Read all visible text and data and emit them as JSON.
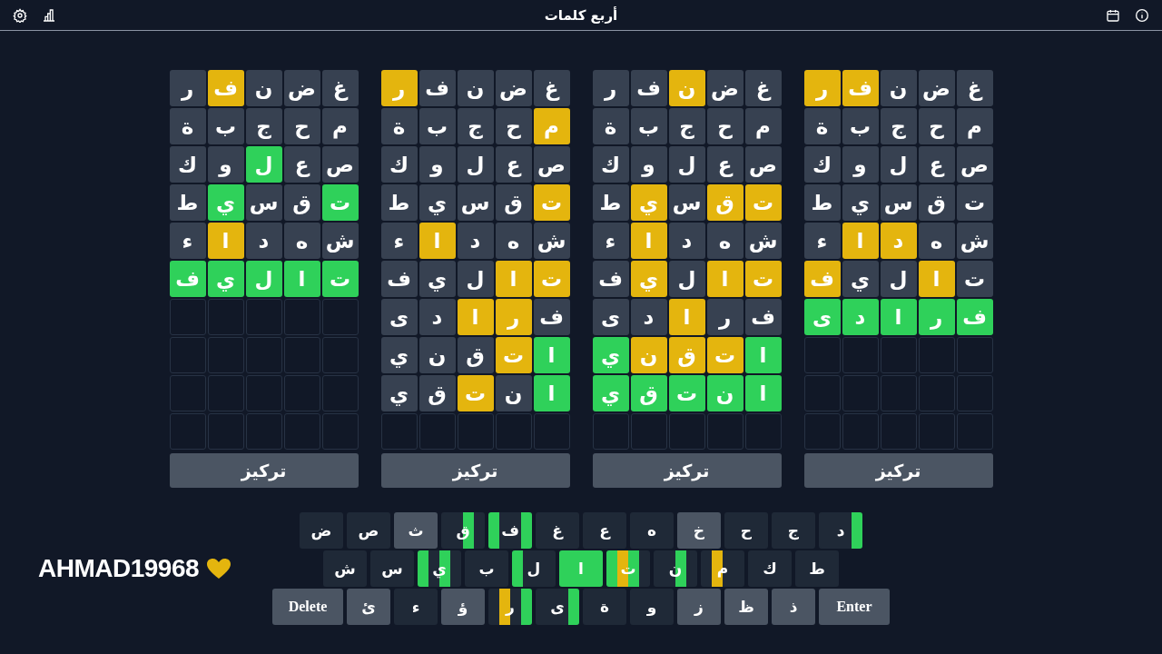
{
  "header": {
    "title": "أربع كلمات"
  },
  "boards": [
    {
      "rows": [
        {
          "cells": [
            {
              "kind": "letter",
              "letter": "غ",
              "color": "#374151"
            },
            {
              "kind": "letter",
              "letter": "ض",
              "color": "#374151"
            },
            {
              "kind": "letter",
              "letter": "ن",
              "color": "#374151"
            },
            {
              "kind": "letter",
              "letter": "ف",
              "color": "#e4b50e"
            },
            {
              "kind": "letter",
              "letter": "ر",
              "color": "#e4b50e"
            }
          ]
        },
        {
          "cells": [
            {
              "kind": "letter",
              "letter": "م",
              "color": "#374151"
            },
            {
              "kind": "letter",
              "letter": "ح",
              "color": "#374151"
            },
            {
              "kind": "letter",
              "letter": "ج",
              "color": "#374151"
            },
            {
              "kind": "letter",
              "letter": "ب",
              "color": "#374151"
            },
            {
              "kind": "letter",
              "letter": "ة",
              "color": "#374151"
            }
          ]
        },
        {
          "cells": [
            {
              "kind": "letter",
              "letter": "ص",
              "color": "#374151"
            },
            {
              "kind": "letter",
              "letter": "ع",
              "color": "#374151"
            },
            {
              "kind": "letter",
              "letter": "ل",
              "color": "#374151"
            },
            {
              "kind": "letter",
              "letter": "و",
              "color": "#374151"
            },
            {
              "kind": "letter",
              "letter": "ك",
              "color": "#374151"
            }
          ]
        },
        {
          "cells": [
            {
              "kind": "letter",
              "letter": "ت",
              "color": "#374151"
            },
            {
              "kind": "letter",
              "letter": "ق",
              "color": "#374151"
            },
            {
              "kind": "letter",
              "letter": "س",
              "color": "#374151"
            },
            {
              "kind": "letter",
              "letter": "ي",
              "color": "#374151"
            },
            {
              "kind": "letter",
              "letter": "ط",
              "color": "#374151"
            }
          ]
        },
        {
          "cells": [
            {
              "kind": "letter",
              "letter": "ش",
              "color": "#374151"
            },
            {
              "kind": "letter",
              "letter": "ه",
              "color": "#374151"
            },
            {
              "kind": "letter",
              "letter": "د",
              "color": "#e4b50e"
            },
            {
              "kind": "letter",
              "letter": "ا",
              "color": "#e4b50e"
            },
            {
              "kind": "letter",
              "letter": "ء",
              "color": "#374151"
            }
          ]
        },
        {
          "cells": [
            {
              "kind": "letter",
              "letter": "ت",
              "color": "#374151"
            },
            {
              "kind": "letter",
              "letter": "ا",
              "color": "#e4b50e"
            },
            {
              "kind": "letter",
              "letter": "ل",
              "color": "#374151"
            },
            {
              "kind": "letter",
              "letter": "ي",
              "color": "#374151"
            },
            {
              "kind": "letter",
              "letter": "ف",
              "color": "#e4b50e"
            }
          ]
        },
        {
          "cells": [
            {
              "kind": "letter",
              "letter": "ف",
              "color": "#2fd15a"
            },
            {
              "kind": "letter",
              "letter": "ر",
              "color": "#2fd15a"
            },
            {
              "kind": "letter",
              "letter": "ا",
              "color": "#2fd15a"
            },
            {
              "kind": "letter",
              "letter": "د",
              "color": "#2fd15a"
            },
            {
              "kind": "letter",
              "letter": "ى",
              "color": "#2fd15a"
            }
          ]
        },
        {
          "cells": [
            {
              "kind": "blank"
            },
            {
              "kind": "blank"
            },
            {
              "kind": "blank"
            },
            {
              "kind": "blank"
            },
            {
              "kind": "blank"
            }
          ]
        },
        {
          "cells": [
            {
              "kind": "blank"
            },
            {
              "kind": "blank"
            },
            {
              "kind": "blank"
            },
            {
              "kind": "blank"
            },
            {
              "kind": "blank"
            }
          ]
        },
        {
          "cells": [
            {
              "kind": "blank"
            },
            {
              "kind": "blank"
            },
            {
              "kind": "blank"
            },
            {
              "kind": "blank"
            },
            {
              "kind": "blank"
            }
          ]
        }
      ],
      "button": "تركيز"
    },
    {
      "rows": [
        {
          "cells": [
            {
              "kind": "letter",
              "letter": "غ",
              "color": "#374151"
            },
            {
              "kind": "letter",
              "letter": "ض",
              "color": "#374151"
            },
            {
              "kind": "letter",
              "letter": "ن",
              "color": "#e4b50e"
            },
            {
              "kind": "letter",
              "letter": "ف",
              "color": "#374151"
            },
            {
              "kind": "letter",
              "letter": "ر",
              "color": "#374151"
            }
          ]
        },
        {
          "cells": [
            {
              "kind": "letter",
              "letter": "م",
              "color": "#374151"
            },
            {
              "kind": "letter",
              "letter": "ح",
              "color": "#374151"
            },
            {
              "kind": "letter",
              "letter": "ج",
              "color": "#374151"
            },
            {
              "kind": "letter",
              "letter": "ب",
              "color": "#374151"
            },
            {
              "kind": "letter",
              "letter": "ة",
              "color": "#374151"
            }
          ]
        },
        {
          "cells": [
            {
              "kind": "letter",
              "letter": "ص",
              "color": "#374151"
            },
            {
              "kind": "letter",
              "letter": "ع",
              "color": "#374151"
            },
            {
              "kind": "letter",
              "letter": "ل",
              "color": "#374151"
            },
            {
              "kind": "letter",
              "letter": "و",
              "color": "#374151"
            },
            {
              "kind": "letter",
              "letter": "ك",
              "color": "#374151"
            }
          ]
        },
        {
          "cells": [
            {
              "kind": "letter",
              "letter": "ت",
              "color": "#e4b50e"
            },
            {
              "kind": "letter",
              "letter": "ق",
              "color": "#e4b50e"
            },
            {
              "kind": "letter",
              "letter": "س",
              "color": "#374151"
            },
            {
              "kind": "letter",
              "letter": "ي",
              "color": "#e4b50e"
            },
            {
              "kind": "letter",
              "letter": "ط",
              "color": "#374151"
            }
          ]
        },
        {
          "cells": [
            {
              "kind": "letter",
              "letter": "ش",
              "color": "#374151"
            },
            {
              "kind": "letter",
              "letter": "ه",
              "color": "#374151"
            },
            {
              "kind": "letter",
              "letter": "د",
              "color": "#374151"
            },
            {
              "kind": "letter",
              "letter": "ا",
              "color": "#e4b50e"
            },
            {
              "kind": "letter",
              "letter": "ء",
              "color": "#374151"
            }
          ]
        },
        {
          "cells": [
            {
              "kind": "letter",
              "letter": "ت",
              "color": "#e4b50e"
            },
            {
              "kind": "letter",
              "letter": "ا",
              "color": "#e4b50e"
            },
            {
              "kind": "letter",
              "letter": "ل",
              "color": "#374151"
            },
            {
              "kind": "letter",
              "letter": "ي",
              "color": "#e4b50e"
            },
            {
              "kind": "letter",
              "letter": "ف",
              "color": "#374151"
            }
          ]
        },
        {
          "cells": [
            {
              "kind": "letter",
              "letter": "ف",
              "color": "#374151"
            },
            {
              "kind": "letter",
              "letter": "ر",
              "color": "#374151"
            },
            {
              "kind": "letter",
              "letter": "ا",
              "color": "#e4b50e"
            },
            {
              "kind": "letter",
              "letter": "د",
              "color": "#374151"
            },
            {
              "kind": "letter",
              "letter": "ى",
              "color": "#374151"
            }
          ]
        },
        {
          "cells": [
            {
              "kind": "letter",
              "letter": "ا",
              "color": "#2fd15a"
            },
            {
              "kind": "letter",
              "letter": "ت",
              "color": "#e4b50e"
            },
            {
              "kind": "letter",
              "letter": "ق",
              "color": "#e4b50e"
            },
            {
              "kind": "letter",
              "letter": "ن",
              "color": "#e4b50e"
            },
            {
              "kind": "letter",
              "letter": "ي",
              "color": "#2fd15a"
            }
          ]
        },
        {
          "cells": [
            {
              "kind": "letter",
              "letter": "ا",
              "color": "#2fd15a"
            },
            {
              "kind": "letter",
              "letter": "ن",
              "color": "#2fd15a"
            },
            {
              "kind": "letter",
              "letter": "ت",
              "color": "#2fd15a"
            },
            {
              "kind": "letter",
              "letter": "ق",
              "color": "#2fd15a"
            },
            {
              "kind": "letter",
              "letter": "ي",
              "color": "#2fd15a"
            }
          ]
        },
        {
          "cells": [
            {
              "kind": "blank"
            },
            {
              "kind": "blank"
            },
            {
              "kind": "blank"
            },
            {
              "kind": "blank"
            },
            {
              "kind": "blank"
            }
          ]
        }
      ],
      "button": "تركيز"
    },
    {
      "rows": [
        {
          "cells": [
            {
              "kind": "letter",
              "letter": "غ",
              "color": "#374151"
            },
            {
              "kind": "letter",
              "letter": "ض",
              "color": "#374151"
            },
            {
              "kind": "letter",
              "letter": "ن",
              "color": "#374151"
            },
            {
              "kind": "letter",
              "letter": "ف",
              "color": "#374151"
            },
            {
              "kind": "letter",
              "letter": "ر",
              "color": "#e4b50e"
            }
          ]
        },
        {
          "cells": [
            {
              "kind": "letter",
              "letter": "م",
              "color": "#e4b50e"
            },
            {
              "kind": "letter",
              "letter": "ح",
              "color": "#374151"
            },
            {
              "kind": "letter",
              "letter": "ج",
              "color": "#374151"
            },
            {
              "kind": "letter",
              "letter": "ب",
              "color": "#374151"
            },
            {
              "kind": "letter",
              "letter": "ة",
              "color": "#374151"
            }
          ]
        },
        {
          "cells": [
            {
              "kind": "letter",
              "letter": "ص",
              "color": "#374151"
            },
            {
              "kind": "letter",
              "letter": "ع",
              "color": "#374151"
            },
            {
              "kind": "letter",
              "letter": "ل",
              "color": "#374151"
            },
            {
              "kind": "letter",
              "letter": "و",
              "color": "#374151"
            },
            {
              "kind": "letter",
              "letter": "ك",
              "color": "#374151"
            }
          ]
        },
        {
          "cells": [
            {
              "kind": "letter",
              "letter": "ت",
              "color": "#e4b50e"
            },
            {
              "kind": "letter",
              "letter": "ق",
              "color": "#374151"
            },
            {
              "kind": "letter",
              "letter": "س",
              "color": "#374151"
            },
            {
              "kind": "letter",
              "letter": "ي",
              "color": "#374151"
            },
            {
              "kind": "letter",
              "letter": "ط",
              "color": "#374151"
            }
          ]
        },
        {
          "cells": [
            {
              "kind": "letter",
              "letter": "ش",
              "color": "#374151"
            },
            {
              "kind": "letter",
              "letter": "ه",
              "color": "#374151"
            },
            {
              "kind": "letter",
              "letter": "د",
              "color": "#374151"
            },
            {
              "kind": "letter",
              "letter": "ا",
              "color": "#e4b50e"
            },
            {
              "kind": "letter",
              "letter": "ء",
              "color": "#374151"
            }
          ]
        },
        {
          "cells": [
            {
              "kind": "letter",
              "letter": "ت",
              "color": "#e4b50e"
            },
            {
              "kind": "letter",
              "letter": "ا",
              "color": "#e4b50e"
            },
            {
              "kind": "letter",
              "letter": "ل",
              "color": "#374151"
            },
            {
              "kind": "letter",
              "letter": "ي",
              "color": "#374151"
            },
            {
              "kind": "letter",
              "letter": "ف",
              "color": "#374151"
            }
          ]
        },
        {
          "cells": [
            {
              "kind": "letter",
              "letter": "ف",
              "color": "#374151"
            },
            {
              "kind": "letter",
              "letter": "ر",
              "color": "#e4b50e"
            },
            {
              "kind": "letter",
              "letter": "ا",
              "color": "#e4b50e"
            },
            {
              "kind": "letter",
              "letter": "د",
              "color": "#374151"
            },
            {
              "kind": "letter",
              "letter": "ى",
              "color": "#374151"
            }
          ]
        },
        {
          "cells": [
            {
              "kind": "letter",
              "letter": "ا",
              "color": "#2fd15a"
            },
            {
              "kind": "letter",
              "letter": "ت",
              "color": "#e4b50e"
            },
            {
              "kind": "letter",
              "letter": "ق",
              "color": "#374151"
            },
            {
              "kind": "letter",
              "letter": "ن",
              "color": "#374151"
            },
            {
              "kind": "letter",
              "letter": "ي",
              "color": "#374151"
            }
          ]
        },
        {
          "cells": [
            {
              "kind": "letter",
              "letter": "ا",
              "color": "#2fd15a"
            },
            {
              "kind": "letter",
              "letter": "ن",
              "color": "#374151"
            },
            {
              "kind": "letter",
              "letter": "ت",
              "color": "#e4b50e"
            },
            {
              "kind": "letter",
              "letter": "ق",
              "color": "#374151"
            },
            {
              "kind": "letter",
              "letter": "ي",
              "color": "#374151"
            }
          ]
        },
        {
          "cells": [
            {
              "kind": "blank"
            },
            {
              "kind": "blank"
            },
            {
              "kind": "blank"
            },
            {
              "kind": "blank"
            },
            {
              "kind": "blank"
            }
          ]
        }
      ],
      "button": "تركيز"
    },
    {
      "rows": [
        {
          "cells": [
            {
              "kind": "letter",
              "letter": "غ",
              "color": "#374151"
            },
            {
              "kind": "letter",
              "letter": "ض",
              "color": "#374151"
            },
            {
              "kind": "letter",
              "letter": "ن",
              "color": "#374151"
            },
            {
              "kind": "letter",
              "letter": "ف",
              "color": "#e4b50e"
            },
            {
              "kind": "letter",
              "letter": "ر",
              "color": "#374151"
            }
          ]
        },
        {
          "cells": [
            {
              "kind": "letter",
              "letter": "م",
              "color": "#374151"
            },
            {
              "kind": "letter",
              "letter": "ح",
              "color": "#374151"
            },
            {
              "kind": "letter",
              "letter": "ج",
              "color": "#374151"
            },
            {
              "kind": "letter",
              "letter": "ب",
              "color": "#374151"
            },
            {
              "kind": "letter",
              "letter": "ة",
              "color": "#374151"
            }
          ]
        },
        {
          "cells": [
            {
              "kind": "letter",
              "letter": "ص",
              "color": "#374151"
            },
            {
              "kind": "letter",
              "letter": "ع",
              "color": "#374151"
            },
            {
              "kind": "letter",
              "letter": "ل",
              "color": "#2fd15a"
            },
            {
              "kind": "letter",
              "letter": "و",
              "color": "#374151"
            },
            {
              "kind": "letter",
              "letter": "ك",
              "color": "#374151"
            }
          ]
        },
        {
          "cells": [
            {
              "kind": "letter",
              "letter": "ت",
              "color": "#2fd15a"
            },
            {
              "kind": "letter",
              "letter": "ق",
              "color": "#374151"
            },
            {
              "kind": "letter",
              "letter": "س",
              "color": "#374151"
            },
            {
              "kind": "letter",
              "letter": "ي",
              "color": "#2fd15a"
            },
            {
              "kind": "letter",
              "letter": "ط",
              "color": "#374151"
            }
          ]
        },
        {
          "cells": [
            {
              "kind": "letter",
              "letter": "ش",
              "color": "#374151"
            },
            {
              "kind": "letter",
              "letter": "ه",
              "color": "#374151"
            },
            {
              "kind": "letter",
              "letter": "د",
              "color": "#374151"
            },
            {
              "kind": "letter",
              "letter": "ا",
              "color": "#e4b50e"
            },
            {
              "kind": "letter",
              "letter": "ء",
              "color": "#374151"
            }
          ]
        },
        {
          "cells": [
            {
              "kind": "letter",
              "letter": "ت",
              "color": "#2fd15a"
            },
            {
              "kind": "letter",
              "letter": "ا",
              "color": "#2fd15a"
            },
            {
              "kind": "letter",
              "letter": "ل",
              "color": "#2fd15a"
            },
            {
              "kind": "letter",
              "letter": "ي",
              "color": "#2fd15a"
            },
            {
              "kind": "letter",
              "letter": "ف",
              "color": "#2fd15a"
            }
          ]
        },
        {
          "cells": [
            {
              "kind": "blank"
            },
            {
              "kind": "blank"
            },
            {
              "kind": "blank"
            },
            {
              "kind": "blank"
            },
            {
              "kind": "blank"
            }
          ]
        },
        {
          "cells": [
            {
              "kind": "blank"
            },
            {
              "kind": "blank"
            },
            {
              "kind": "blank"
            },
            {
              "kind": "blank"
            },
            {
              "kind": "blank"
            }
          ]
        },
        {
          "cells": [
            {
              "kind": "blank"
            },
            {
              "kind": "blank"
            },
            {
              "kind": "blank"
            },
            {
              "kind": "blank"
            },
            {
              "kind": "blank"
            }
          ]
        },
        {
          "cells": [
            {
              "kind": "blank"
            },
            {
              "kind": "blank"
            },
            {
              "kind": "blank"
            },
            {
              "kind": "blank"
            },
            {
              "kind": "blank"
            }
          ]
        }
      ],
      "button": "تركيز"
    }
  ],
  "player": {
    "name": "AHMAD19968"
  },
  "keyboard": {
    "rows": [
      {
        "keys": [
          {
            "label": "د",
            "kind": "letter",
            "color": "#1f2937",
            "stripes": [
              {
                "on": true,
                "color": "#2fd15a"
              },
              {
                "on": false
              },
              {
                "on": false
              },
              {
                "on": false
              }
            ]
          },
          {
            "label": "ج",
            "kind": "letter",
            "color": "#1f2937",
            "stripes": [
              {
                "on": false
              },
              {
                "on": false
              },
              {
                "on": false
              },
              {
                "on": false
              }
            ]
          },
          {
            "label": "ح",
            "kind": "letter",
            "color": "#1f2937",
            "stripes": [
              {
                "on": false
              },
              {
                "on": false
              },
              {
                "on": false
              },
              {
                "on": false
              }
            ]
          },
          {
            "label": "خ",
            "kind": "letter",
            "color": "#4b5563",
            "stripes": [
              {
                "on": false
              },
              {
                "on": false
              },
              {
                "on": false
              },
              {
                "on": false
              }
            ]
          },
          {
            "label": "ه",
            "kind": "letter",
            "color": "#1f2937",
            "stripes": [
              {
                "on": false
              },
              {
                "on": false
              },
              {
                "on": false
              },
              {
                "on": false
              }
            ]
          },
          {
            "label": "ع",
            "kind": "letter",
            "color": "#1f2937",
            "stripes": [
              {
                "on": false
              },
              {
                "on": false
              },
              {
                "on": false
              },
              {
                "on": false
              }
            ]
          },
          {
            "label": "غ",
            "kind": "letter",
            "color": "#1f2937",
            "stripes": [
              {
                "on": false
              },
              {
                "on": false
              },
              {
                "on": false
              },
              {
                "on": false
              }
            ]
          },
          {
            "label": "ف",
            "kind": "letter",
            "color": "#1f2937",
            "stripes": [
              {
                "on": true,
                "color": "#2fd15a"
              },
              {
                "on": false
              },
              {
                "on": false
              },
              {
                "on": true,
                "color": "#2fd15a"
              }
            ]
          },
          {
            "label": "ق",
            "kind": "letter",
            "color": "#1f2937",
            "stripes": [
              {
                "on": false
              },
              {
                "on": true,
                "color": "#2fd15a"
              },
              {
                "on": false
              },
              {
                "on": false
              }
            ]
          },
          {
            "label": "ث",
            "kind": "letter",
            "color": "#4b5563",
            "stripes": [
              {
                "on": false
              },
              {
                "on": false
              },
              {
                "on": false
              },
              {
                "on": false
              }
            ]
          },
          {
            "label": "ص",
            "kind": "letter",
            "color": "#1f2937",
            "stripes": [
              {
                "on": false
              },
              {
                "on": false
              },
              {
                "on": false
              },
              {
                "on": false
              }
            ]
          },
          {
            "label": "ض",
            "kind": "letter",
            "color": "#1f2937",
            "stripes": [
              {
                "on": false
              },
              {
                "on": false
              },
              {
                "on": false
              },
              {
                "on": false
              }
            ]
          }
        ]
      },
      {
        "keys": [
          {
            "label": "ط",
            "kind": "letter",
            "color": "#1f2937",
            "stripes": [
              {
                "on": false
              },
              {
                "on": false
              },
              {
                "on": false
              },
              {
                "on": false
              }
            ]
          },
          {
            "label": "ك",
            "kind": "letter",
            "color": "#1f2937",
            "stripes": [
              {
                "on": false
              },
              {
                "on": false
              },
              {
                "on": false
              },
              {
                "on": false
              }
            ]
          },
          {
            "label": "م",
            "kind": "letter",
            "color": "#1f2937",
            "stripes": [
              {
                "on": false
              },
              {
                "on": false
              },
              {
                "on": true,
                "color": "#e4b50e"
              },
              {
                "on": false
              }
            ]
          },
          {
            "label": "ن",
            "kind": "letter",
            "color": "#1f2937",
            "stripes": [
              {
                "on": false
              },
              {
                "on": true,
                "color": "#2fd15a"
              },
              {
                "on": false
              },
              {
                "on": false
              }
            ]
          },
          {
            "label": "ت",
            "kind": "letter",
            "color": "#1f2937",
            "stripes": [
              {
                "on": false
              },
              {
                "on": true,
                "color": "#2fd15a"
              },
              {
                "on": true,
                "color": "#e4b50e"
              },
              {
                "on": true,
                "color": "#2fd15a"
              }
            ]
          },
          {
            "label": "ا",
            "kind": "letter",
            "color": "#2fd15a"
          },
          {
            "label": "ل",
            "kind": "letter",
            "color": "#1f2937",
            "stripes": [
              {
                "on": false
              },
              {
                "on": false
              },
              {
                "on": false
              },
              {
                "on": true,
                "color": "#2fd15a"
              }
            ]
          },
          {
            "label": "ب",
            "kind": "letter",
            "color": "#1f2937",
            "stripes": [
              {
                "on": false
              },
              {
                "on": false
              },
              {
                "on": false
              },
              {
                "on": false
              }
            ]
          },
          {
            "label": "ي",
            "kind": "letter",
            "color": "#1f2937",
            "stripes": [
              {
                "on": false
              },
              {
                "on": true,
                "color": "#2fd15a"
              },
              {
                "on": false
              },
              {
                "on": true,
                "color": "#2fd15a"
              }
            ]
          },
          {
            "label": "س",
            "kind": "letter",
            "color": "#1f2937",
            "stripes": [
              {
                "on": false
              },
              {
                "on": false
              },
              {
                "on": false
              },
              {
                "on": false
              }
            ]
          },
          {
            "label": "ش",
            "kind": "letter",
            "color": "#1f2937",
            "stripes": [
              {
                "on": false
              },
              {
                "on": false
              },
              {
                "on": false
              },
              {
                "on": false
              }
            ]
          }
        ]
      },
      {
        "keys": [
          {
            "label": "Enter",
            "kind": "action",
            "color": "#4b5563",
            "stripes": [
              {
                "on": false
              },
              {
                "on": false
              },
              {
                "on": false
              },
              {
                "on": false
              }
            ]
          },
          {
            "label": "ذ",
            "kind": "letter",
            "color": "#4b5563",
            "stripes": [
              {
                "on": false
              },
              {
                "on": false
              },
              {
                "on": false
              },
              {
                "on": false
              }
            ]
          },
          {
            "label": "ظ",
            "kind": "letter",
            "color": "#4b5563",
            "stripes": [
              {
                "on": false
              },
              {
                "on": false
              },
              {
                "on": false
              },
              {
                "on": false
              }
            ]
          },
          {
            "label": "ز",
            "kind": "letter",
            "color": "#4b5563",
            "stripes": [
              {
                "on": false
              },
              {
                "on": false
              },
              {
                "on": false
              },
              {
                "on": false
              }
            ]
          },
          {
            "label": "و",
            "kind": "letter",
            "color": "#1f2937",
            "stripes": [
              {
                "on": false
              },
              {
                "on": false
              },
              {
                "on": false
              },
              {
                "on": false
              }
            ]
          },
          {
            "label": "ة",
            "kind": "letter",
            "color": "#1f2937",
            "stripes": [
              {
                "on": false
              },
              {
                "on": false
              },
              {
                "on": false
              },
              {
                "on": false
              }
            ]
          },
          {
            "label": "ى",
            "kind": "letter",
            "color": "#1f2937",
            "stripes": [
              {
                "on": true,
                "color": "#2fd15a"
              },
              {
                "on": false
              },
              {
                "on": false
              },
              {
                "on": false
              }
            ]
          },
          {
            "label": "ر",
            "kind": "letter",
            "color": "#1f2937",
            "stripes": [
              {
                "on": true,
                "color": "#2fd15a"
              },
              {
                "on": false
              },
              {
                "on": true,
                "color": "#e4b50e"
              },
              {
                "on": false
              }
            ]
          },
          {
            "label": "ؤ",
            "kind": "letter",
            "color": "#4b5563",
            "stripes": [
              {
                "on": false
              },
              {
                "on": false
              },
              {
                "on": false
              },
              {
                "on": false
              }
            ]
          },
          {
            "label": "ء",
            "kind": "letter",
            "color": "#1f2937",
            "stripes": [
              {
                "on": false
              },
              {
                "on": false
              },
              {
                "on": false
              },
              {
                "on": false
              }
            ]
          },
          {
            "label": "ئ",
            "kind": "letter",
            "color": "#4b5563",
            "stripes": [
              {
                "on": false
              },
              {
                "on": false
              },
              {
                "on": false
              },
              {
                "on": false
              }
            ]
          },
          {
            "label": "Delete",
            "kind": "action",
            "color": "#4b5563",
            "stripes": [
              {
                "on": false
              },
              {
                "on": false
              },
              {
                "on": false
              },
              {
                "on": false
              }
            ]
          }
        ]
      }
    ]
  }
}
